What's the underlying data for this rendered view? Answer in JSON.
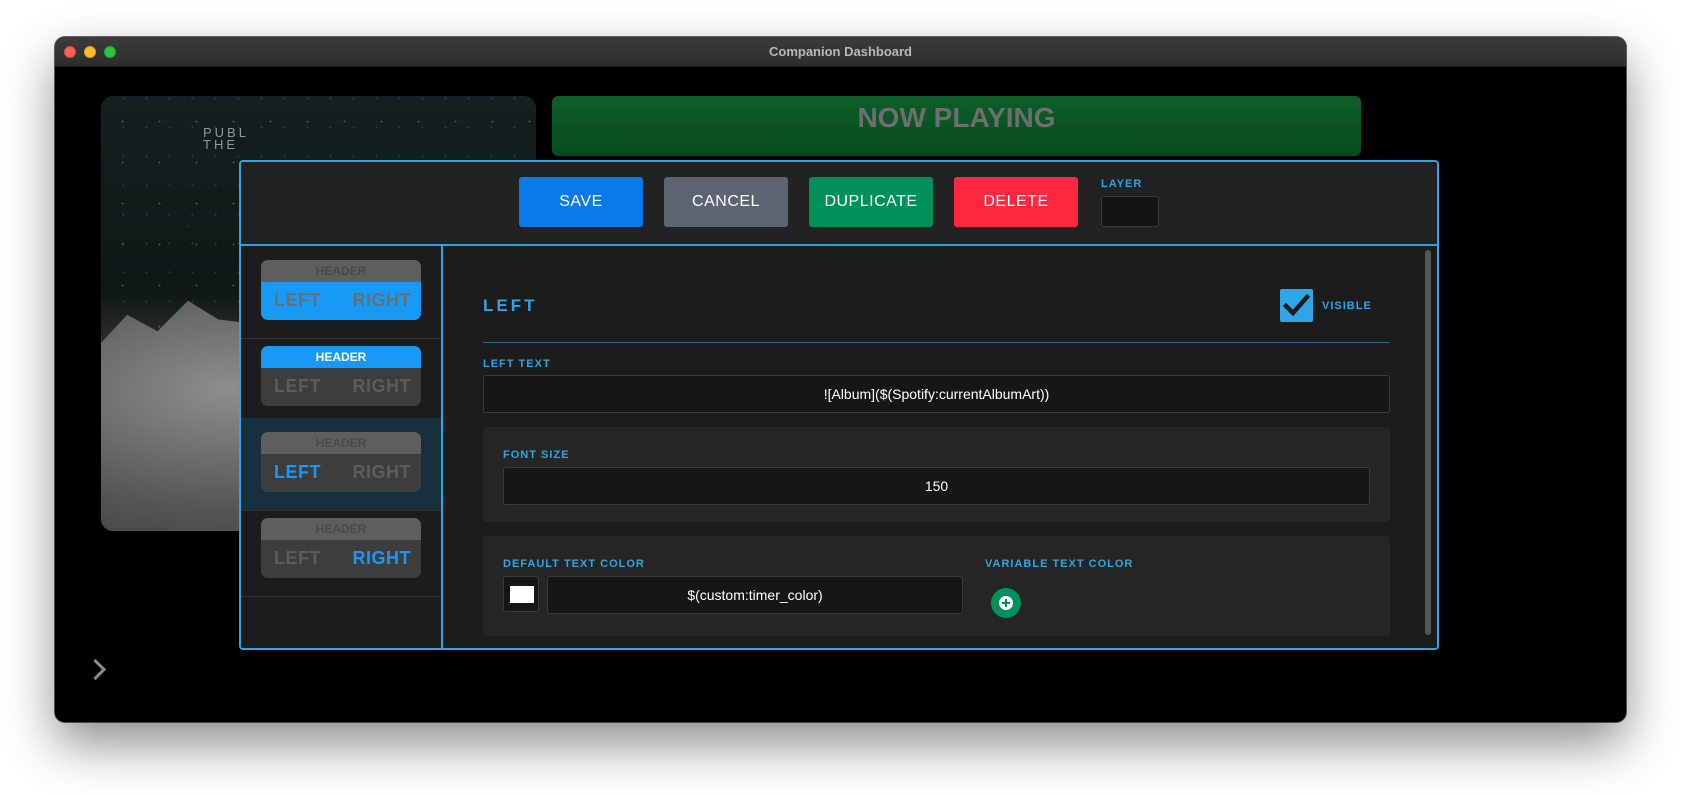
{
  "window": {
    "title": "Companion Dashboard"
  },
  "background": {
    "album_text_line1": "PUBL",
    "album_text_line2": "THE",
    "now_playing": "NOW PLAYING"
  },
  "toolbar": {
    "save_label": "SAVE",
    "cancel_label": "CANCEL",
    "duplicate_label": "DUPLICATE",
    "delete_label": "DELETE",
    "layer_label": "LAYER",
    "layer_value": ""
  },
  "layouts": [
    {
      "header": "HEADER",
      "left": "LEFT",
      "right": "RIGHT",
      "highlight": "body"
    },
    {
      "header": "HEADER",
      "left": "LEFT",
      "right": "RIGHT",
      "highlight": "header"
    },
    {
      "header": "HEADER",
      "left": "LEFT",
      "right": "RIGHT",
      "highlight": "left",
      "selected": true
    },
    {
      "header": "HEADER",
      "left": "LEFT",
      "right": "RIGHT",
      "highlight": "right"
    }
  ],
  "panel": {
    "section_title": "LEFT",
    "visible_label": "VISIBLE",
    "visible_checked": true,
    "left_text_label": "LEFT TEXT",
    "left_text_value": "![Album]($(Spotify:currentAlbumArt))",
    "font_size_label": "FONT SIZE",
    "font_size_value": "150",
    "default_color_label": "DEFAULT TEXT COLOR",
    "default_color_value": "$(custom:timer_color)",
    "default_color_swatch": "#ffffff",
    "variable_color_label": "VARIABLE TEXT COLOR"
  },
  "colors": {
    "accent": "#2ea5e6",
    "save": "#0a7ae8",
    "cancel": "#5c6471",
    "duplicate": "#00915a",
    "delete": "#ff263f"
  }
}
